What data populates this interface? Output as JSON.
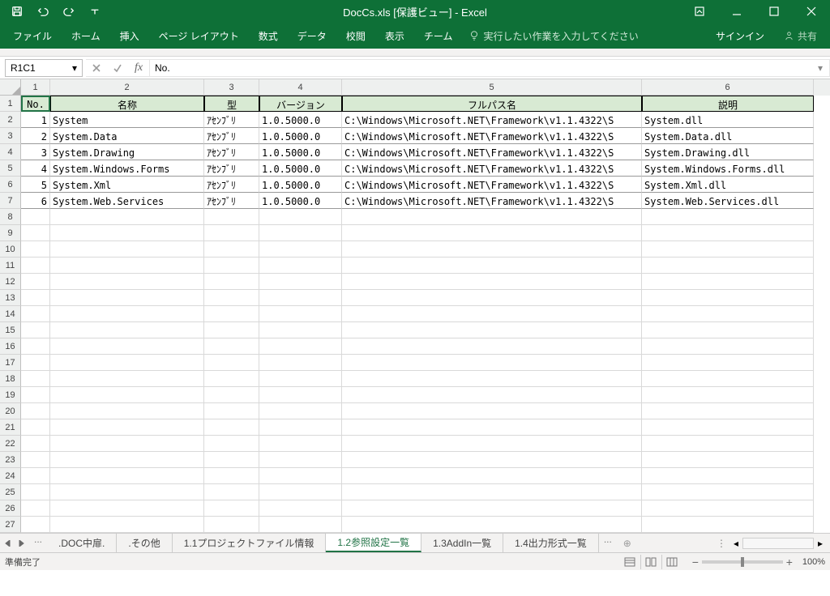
{
  "window": {
    "title": "DocCs.xls  [保護ビュー] - Excel"
  },
  "ribbon": {
    "tabs": [
      "ファイル",
      "ホーム",
      "挿入",
      "ページ レイアウト",
      "数式",
      "データ",
      "校閲",
      "表示",
      "チーム"
    ],
    "tell_me": "実行したい作業を入力してください",
    "signin": "サインイン",
    "share": "共有"
  },
  "namebox": {
    "value": "R1C1"
  },
  "formula": {
    "value": "No."
  },
  "columns": {
    "numbers": [
      "1",
      "2",
      "3",
      "4",
      "5",
      "6"
    ]
  },
  "headers": {
    "no": "No.",
    "name": "名称",
    "type": "型",
    "version": "バージョン",
    "fullpath": "フルパス名",
    "desc": "説明"
  },
  "rows": [
    {
      "no": "1",
      "name": "System",
      "type": "ｱｾﾝﾌﾞﾘ",
      "version": "1.0.5000.0",
      "path_vis": "C:\\Windows\\Microsoft.NET\\Framework\\v1.1.4322\\S",
      "path_tail": "System.dll"
    },
    {
      "no": "2",
      "name": "System.Data",
      "type": "ｱｾﾝﾌﾞﾘ",
      "version": "1.0.5000.0",
      "path_vis": "C:\\Windows\\Microsoft.NET\\Framework\\v1.1.4322\\S",
      "path_tail": "System.Data.dll"
    },
    {
      "no": "3",
      "name": "System.Drawing",
      "type": "ｱｾﾝﾌﾞﾘ",
      "version": "1.0.5000.0",
      "path_vis": "C:\\Windows\\Microsoft.NET\\Framework\\v1.1.4322\\S",
      "path_tail": "System.Drawing.dll"
    },
    {
      "no": "4",
      "name": "System.Windows.Forms",
      "type": "ｱｾﾝﾌﾞﾘ",
      "version": "1.0.5000.0",
      "path_vis": "C:\\Windows\\Microsoft.NET\\Framework\\v1.1.4322\\S",
      "path_tail": "System.Windows.Forms.dll"
    },
    {
      "no": "5",
      "name": "System.Xml",
      "type": "ｱｾﾝﾌﾞﾘ",
      "version": "1.0.5000.0",
      "path_vis": "C:\\Windows\\Microsoft.NET\\Framework\\v1.1.4322\\S",
      "path_tail": "System.Xml.dll"
    },
    {
      "no": "6",
      "name": "System.Web.Services",
      "type": "ｱｾﾝﾌﾞﾘ",
      "version": "1.0.5000.0",
      "path_vis": "C:\\Windows\\Microsoft.NET\\Framework\\v1.1.4322\\S",
      "path_tail": "System.Web.Services.dll"
    }
  ],
  "empty_row_count": 20,
  "sheet_tabs": {
    "ellipsis": "...",
    "tabs": [
      {
        "label": ".DOC中扉.",
        "active": false
      },
      {
        "label": ".その他",
        "active": false
      },
      {
        "label": "1.1プロジェクトファイル情報",
        "active": false
      },
      {
        "label": "1.2参照設定一覧",
        "active": true
      },
      {
        "label": "1.3AddIn一覧",
        "active": false
      },
      {
        "label": "1.4出力形式一覧",
        "active": false
      }
    ],
    "trailing": "..."
  },
  "status": {
    "ready": "準備完了",
    "zoom": "100%"
  }
}
